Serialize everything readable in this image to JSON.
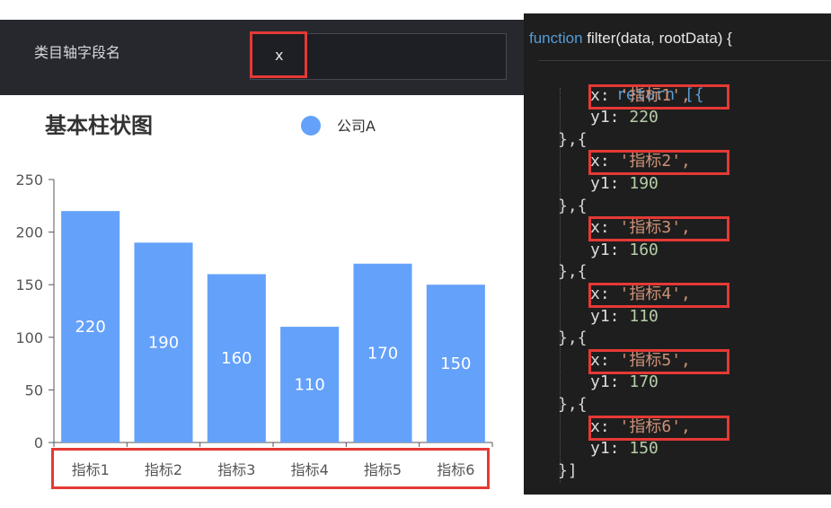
{
  "config": {
    "label": "类目轴字段名",
    "input_value": "x"
  },
  "chart_data": {
    "type": "bar",
    "title": "基本柱状图",
    "legend": [
      "公司A"
    ],
    "legend_position": "top-right",
    "categories": [
      "指标1",
      "指标2",
      "指标3",
      "指标4",
      "指标5",
      "指标6"
    ],
    "series": [
      {
        "name": "公司A",
        "values": [
          220,
          190,
          160,
          110,
          170,
          150
        ],
        "color": "#64a1fa"
      }
    ],
    "yticks": [
      0,
      50,
      100,
      150,
      200,
      250
    ],
    "ylim": [
      0,
      250
    ],
    "data_labels": true,
    "grid": false
  },
  "code": {
    "fn_keyword": "function",
    "fn_signature": "filter(data, rootData) {",
    "return_line": "return [{",
    "items": [
      {
        "x": "'指标1',",
        "y1": "220"
      },
      {
        "x": "'指标2',",
        "y1": "190"
      },
      {
        "x": "'指标3',",
        "y1": "160"
      },
      {
        "x": "'指标4',",
        "y1": "110"
      },
      {
        "x": "'指标5',",
        "y1": "170"
      },
      {
        "x": "'指标6',",
        "y1": "150"
      }
    ],
    "separator": "},{",
    "closing": "}]"
  },
  "colors": {
    "bar": "#64a1fa",
    "highlight": "#e53935",
    "code_bg": "#1e1e1e",
    "config_bg": "#26282e"
  }
}
